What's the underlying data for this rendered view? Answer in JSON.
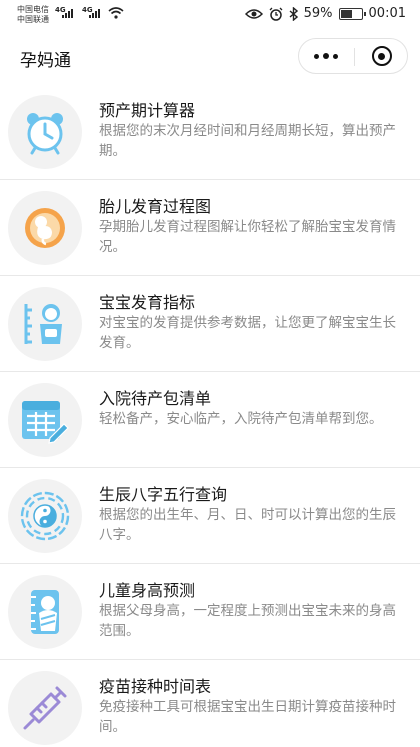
{
  "status_bar": {
    "carrier_1": "中国电信",
    "carrier_2": "中国联通",
    "network_1": "4G",
    "network_2": "4G",
    "battery_percent": "59%",
    "battery_level": 0.59,
    "time": "00:01",
    "icons": [
      "eye-icon",
      "alarm-icon",
      "bluetooth-icon",
      "battery-icon",
      "wifi-icon",
      "signal-icon"
    ]
  },
  "nav": {
    "title": "孕妈通",
    "capsule": {
      "more_icon": "more-dots-icon",
      "close_icon": "close-miniprogram-icon"
    }
  },
  "items": [
    {
      "title": "预产期计算器",
      "desc": "根据您的末次月经时间和月经周期长短，算出预产期。",
      "icon": "alarm-clock-icon"
    },
    {
      "title": "胎儿发育过程图",
      "desc": "孕期胎儿发育过程图解让你轻松了解胎宝宝发育情况。",
      "icon": "fetus-icon"
    },
    {
      "title": "宝宝发育指标",
      "desc": "对宝宝的发育提供参考数据，让您更了解宝宝生长发育。",
      "icon": "baby-height-icon"
    },
    {
      "title": "入院待产包清单",
      "desc": "轻松备产，安心临产，入院待产包清单帮到您。",
      "icon": "checklist-icon"
    },
    {
      "title": "生辰八字五行查询",
      "desc": "根据您的出生年、月、日、时可以计算出您的生辰八字。",
      "icon": "bagua-icon"
    },
    {
      "title": "儿童身高预测",
      "desc": "根据父母身高，一定程度上预测出宝宝未来的身高范围。",
      "icon": "swaddled-baby-icon"
    },
    {
      "title": "疫苗接种时间表",
      "desc": "免疫接种工具可根据宝宝出生日期计算疫苗接种时间。",
      "icon": "syringe-icon"
    }
  ],
  "colors": {
    "accent_blue": "#6cc3ee",
    "accent_orange": "#f5a34a",
    "accent_purple": "#9b8ad6",
    "icon_bg": "#f2f2f2"
  }
}
